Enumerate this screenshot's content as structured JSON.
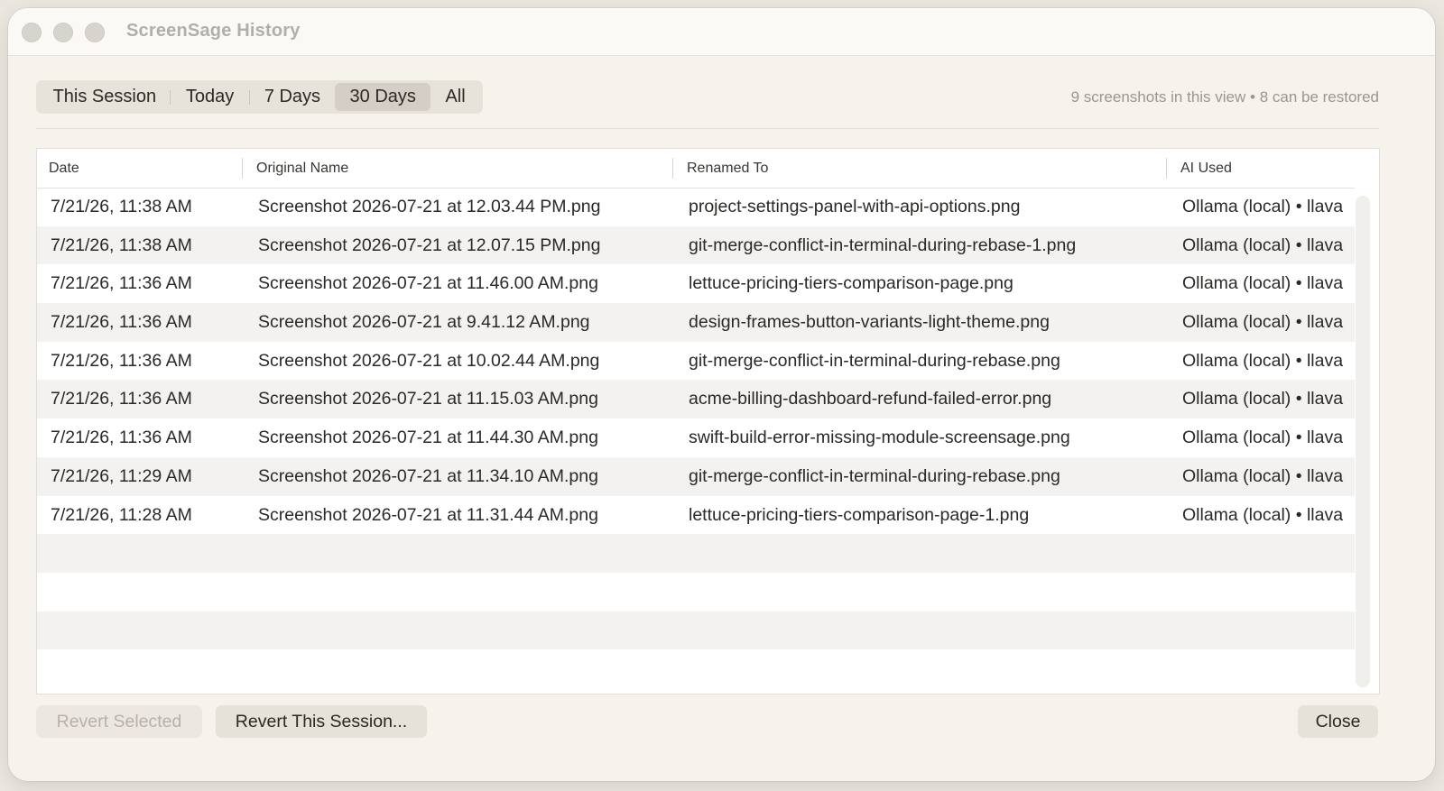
{
  "window": {
    "title": "ScreenSage History"
  },
  "filters": {
    "options": [
      "This Session",
      "Today",
      "7 Days",
      "30 Days",
      "All"
    ],
    "selected": "30 Days"
  },
  "summary": "9 screenshots in this view • 8 can be restored",
  "table": {
    "columns": [
      "Date",
      "Original Name",
      "Renamed To",
      "AI Used"
    ],
    "rows": [
      [
        "7/21/26, 11:38 AM",
        "Screenshot 2026-07-21 at 12.03.44 PM.png",
        "project-settings-panel-with-api-options.png",
        "Ollama (local) • llava"
      ],
      [
        "7/21/26, 11:38 AM",
        "Screenshot 2026-07-21 at 12.07.15 PM.png",
        "git-merge-conflict-in-terminal-during-rebase-1.png",
        "Ollama (local) • llava"
      ],
      [
        "7/21/26, 11:36 AM",
        "Screenshot 2026-07-21 at 11.46.00 AM.png",
        "lettuce-pricing-tiers-comparison-page.png",
        "Ollama (local) • llava"
      ],
      [
        "7/21/26, 11:36 AM",
        "Screenshot 2026-07-21 at 9.41.12 AM.png",
        "design-frames-button-variants-light-theme.png",
        "Ollama (local) • llava"
      ],
      [
        "7/21/26, 11:36 AM",
        "Screenshot 2026-07-21 at 10.02.44 AM.png",
        "git-merge-conflict-in-terminal-during-rebase.png",
        "Ollama (local) • llava"
      ],
      [
        "7/21/26, 11:36 AM",
        "Screenshot 2026-07-21 at 11.15.03 AM.png",
        "acme-billing-dashboard-refund-failed-error.png",
        "Ollama (local) • llava"
      ],
      [
        "7/21/26, 11:36 AM",
        "Screenshot 2026-07-21 at 11.44.30 AM.png",
        "swift-build-error-missing-module-screensage.png",
        "Ollama (local) • llava"
      ],
      [
        "7/21/26, 11:29 AM",
        "Screenshot 2026-07-21 at 11.34.10 AM.png",
        "git-merge-conflict-in-terminal-during-rebase.png",
        "Ollama (local) • llava"
      ],
      [
        "7/21/26, 11:28 AM",
        "Screenshot 2026-07-21 at 11.31.44 AM.png",
        "lettuce-pricing-tiers-comparison-page-1.png",
        "Ollama (local) • llava"
      ]
    ]
  },
  "buttons": {
    "revert_selected": "Revert Selected",
    "revert_session": "Revert This Session...",
    "close": "Close"
  }
}
